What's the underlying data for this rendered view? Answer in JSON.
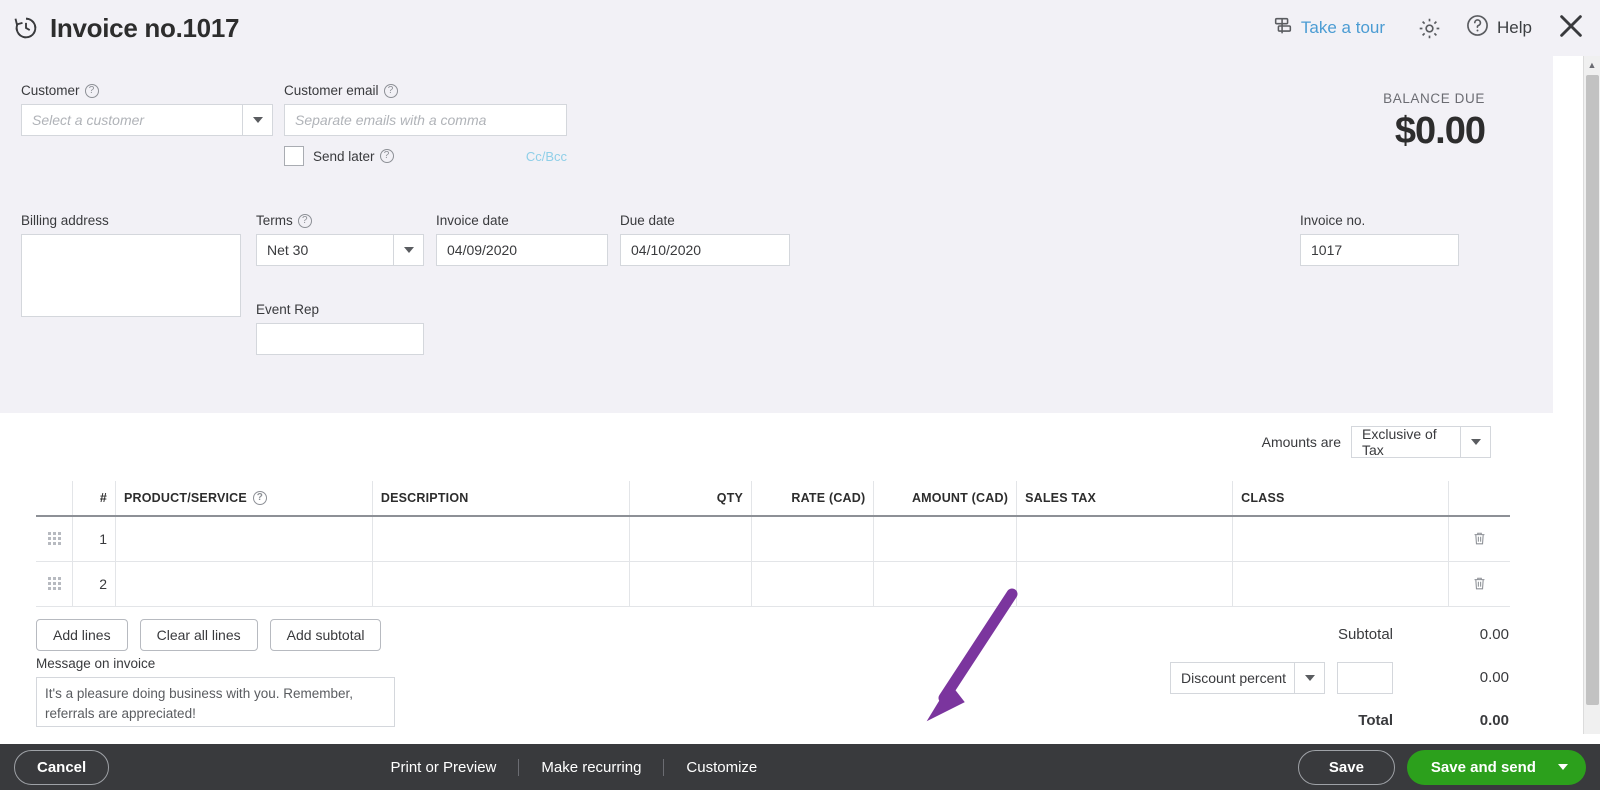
{
  "header": {
    "title": "Invoice no.1017",
    "history_icon": "history-clock-icon",
    "tour_label": "Take a tour",
    "tour_icon": "signpost-icon",
    "gear_icon": "gear-icon",
    "help_icon": "question-circle-icon",
    "help_label": "Help",
    "close_icon": "close-x-icon"
  },
  "customer": {
    "label": "Customer",
    "placeholder": "Select a customer",
    "value": ""
  },
  "email": {
    "label": "Customer email",
    "placeholder": "Separate emails with a comma",
    "value": "",
    "send_later_label": "Send later",
    "send_later_checked": false,
    "ccbcc_label": "Cc/Bcc"
  },
  "balance": {
    "label": "BALANCE DUE",
    "amount": "$0.00"
  },
  "billing": {
    "label": "Billing address",
    "value": ""
  },
  "terms": {
    "label": "Terms",
    "value": "Net 30"
  },
  "invoice_date": {
    "label": "Invoice date",
    "value": "04/09/2020"
  },
  "due_date": {
    "label": "Due date",
    "value": "04/10/2020"
  },
  "event_rep": {
    "label": "Event Rep",
    "value": ""
  },
  "invoice_no": {
    "label": "Invoice no.",
    "value": "1017"
  },
  "amounts_are": {
    "label": "Amounts are",
    "value": "Exclusive of Tax"
  },
  "items_table": {
    "columns": [
      "#",
      "PRODUCT/SERVICE",
      "DESCRIPTION",
      "QTY",
      "RATE (CAD)",
      "AMOUNT (CAD)",
      "SALES TAX",
      "CLASS"
    ],
    "rows": [
      {
        "num": "1",
        "product": "",
        "description": "",
        "qty": "",
        "rate": "",
        "amount": "",
        "sales_tax": "",
        "class": ""
      },
      {
        "num": "2",
        "product": "",
        "description": "",
        "qty": "",
        "rate": "",
        "amount": "",
        "sales_tax": "",
        "class": ""
      }
    ]
  },
  "line_buttons": {
    "add_lines": "Add lines",
    "clear_all_lines": "Clear all lines",
    "add_subtotal": "Add subtotal"
  },
  "message": {
    "label": "Message on invoice",
    "value": "It's a pleasure doing business with you.  Remember, referrals are appreciated!"
  },
  "totals": {
    "subtotal_label": "Subtotal",
    "subtotal_value": "0.00",
    "discount_type": "Discount percent",
    "discount_input": "",
    "discount_value": "0.00",
    "total_label": "Total",
    "total_value": "0.00"
  },
  "bottom_bar": {
    "cancel": "Cancel",
    "print_or_preview": "Print or Preview",
    "make_recurring": "Make recurring",
    "customize": "Customize",
    "save": "Save",
    "save_and_send": "Save and send"
  },
  "annotation": {
    "arrow_color": "#7b359e",
    "points_to": "Customize"
  },
  "colors": {
    "form_background": "#f2f1f6",
    "bottom_bar": "#393a3d",
    "primary_green": "#2ca01c",
    "link_blue": "#4b9cd3"
  }
}
